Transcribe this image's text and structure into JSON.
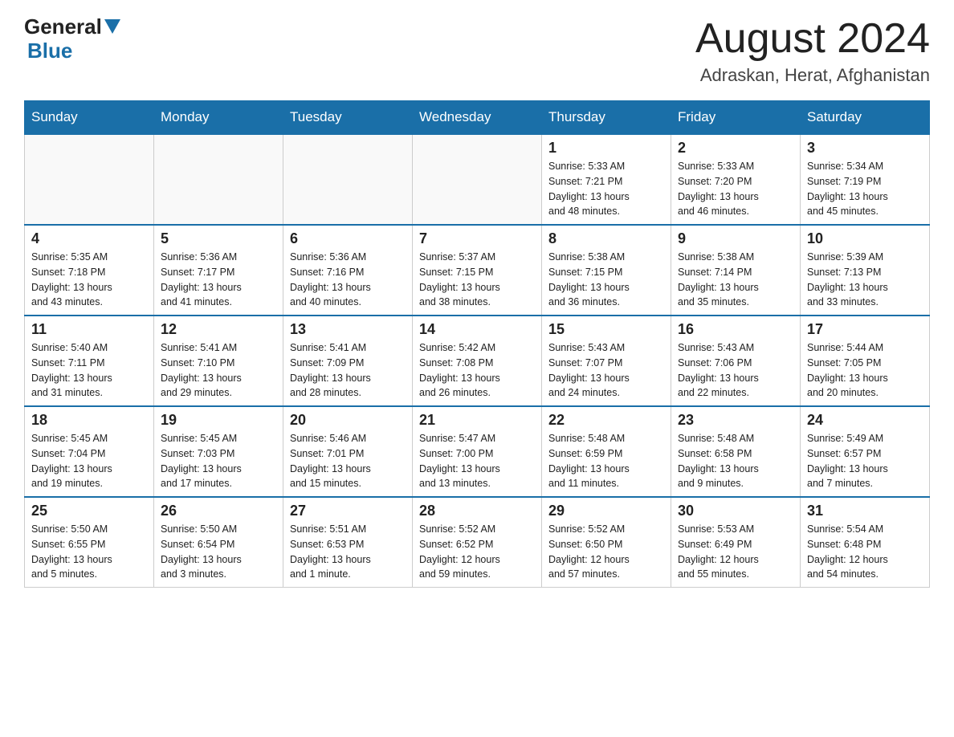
{
  "header": {
    "logo_general": "General",
    "logo_blue": "Blue",
    "month_title": "August 2024",
    "location": "Adraskan, Herat, Afghanistan"
  },
  "days_of_week": [
    "Sunday",
    "Monday",
    "Tuesday",
    "Wednesday",
    "Thursday",
    "Friday",
    "Saturday"
  ],
  "weeks": [
    [
      {
        "day": "",
        "info": ""
      },
      {
        "day": "",
        "info": ""
      },
      {
        "day": "",
        "info": ""
      },
      {
        "day": "",
        "info": ""
      },
      {
        "day": "1",
        "info": "Sunrise: 5:33 AM\nSunset: 7:21 PM\nDaylight: 13 hours\nand 48 minutes."
      },
      {
        "day": "2",
        "info": "Sunrise: 5:33 AM\nSunset: 7:20 PM\nDaylight: 13 hours\nand 46 minutes."
      },
      {
        "day": "3",
        "info": "Sunrise: 5:34 AM\nSunset: 7:19 PM\nDaylight: 13 hours\nand 45 minutes."
      }
    ],
    [
      {
        "day": "4",
        "info": "Sunrise: 5:35 AM\nSunset: 7:18 PM\nDaylight: 13 hours\nand 43 minutes."
      },
      {
        "day": "5",
        "info": "Sunrise: 5:36 AM\nSunset: 7:17 PM\nDaylight: 13 hours\nand 41 minutes."
      },
      {
        "day": "6",
        "info": "Sunrise: 5:36 AM\nSunset: 7:16 PM\nDaylight: 13 hours\nand 40 minutes."
      },
      {
        "day": "7",
        "info": "Sunrise: 5:37 AM\nSunset: 7:15 PM\nDaylight: 13 hours\nand 38 minutes."
      },
      {
        "day": "8",
        "info": "Sunrise: 5:38 AM\nSunset: 7:15 PM\nDaylight: 13 hours\nand 36 minutes."
      },
      {
        "day": "9",
        "info": "Sunrise: 5:38 AM\nSunset: 7:14 PM\nDaylight: 13 hours\nand 35 minutes."
      },
      {
        "day": "10",
        "info": "Sunrise: 5:39 AM\nSunset: 7:13 PM\nDaylight: 13 hours\nand 33 minutes."
      }
    ],
    [
      {
        "day": "11",
        "info": "Sunrise: 5:40 AM\nSunset: 7:11 PM\nDaylight: 13 hours\nand 31 minutes."
      },
      {
        "day": "12",
        "info": "Sunrise: 5:41 AM\nSunset: 7:10 PM\nDaylight: 13 hours\nand 29 minutes."
      },
      {
        "day": "13",
        "info": "Sunrise: 5:41 AM\nSunset: 7:09 PM\nDaylight: 13 hours\nand 28 minutes."
      },
      {
        "day": "14",
        "info": "Sunrise: 5:42 AM\nSunset: 7:08 PM\nDaylight: 13 hours\nand 26 minutes."
      },
      {
        "day": "15",
        "info": "Sunrise: 5:43 AM\nSunset: 7:07 PM\nDaylight: 13 hours\nand 24 minutes."
      },
      {
        "day": "16",
        "info": "Sunrise: 5:43 AM\nSunset: 7:06 PM\nDaylight: 13 hours\nand 22 minutes."
      },
      {
        "day": "17",
        "info": "Sunrise: 5:44 AM\nSunset: 7:05 PM\nDaylight: 13 hours\nand 20 minutes."
      }
    ],
    [
      {
        "day": "18",
        "info": "Sunrise: 5:45 AM\nSunset: 7:04 PM\nDaylight: 13 hours\nand 19 minutes."
      },
      {
        "day": "19",
        "info": "Sunrise: 5:45 AM\nSunset: 7:03 PM\nDaylight: 13 hours\nand 17 minutes."
      },
      {
        "day": "20",
        "info": "Sunrise: 5:46 AM\nSunset: 7:01 PM\nDaylight: 13 hours\nand 15 minutes."
      },
      {
        "day": "21",
        "info": "Sunrise: 5:47 AM\nSunset: 7:00 PM\nDaylight: 13 hours\nand 13 minutes."
      },
      {
        "day": "22",
        "info": "Sunrise: 5:48 AM\nSunset: 6:59 PM\nDaylight: 13 hours\nand 11 minutes."
      },
      {
        "day": "23",
        "info": "Sunrise: 5:48 AM\nSunset: 6:58 PM\nDaylight: 13 hours\nand 9 minutes."
      },
      {
        "day": "24",
        "info": "Sunrise: 5:49 AM\nSunset: 6:57 PM\nDaylight: 13 hours\nand 7 minutes."
      }
    ],
    [
      {
        "day": "25",
        "info": "Sunrise: 5:50 AM\nSunset: 6:55 PM\nDaylight: 13 hours\nand 5 minutes."
      },
      {
        "day": "26",
        "info": "Sunrise: 5:50 AM\nSunset: 6:54 PM\nDaylight: 13 hours\nand 3 minutes."
      },
      {
        "day": "27",
        "info": "Sunrise: 5:51 AM\nSunset: 6:53 PM\nDaylight: 13 hours\nand 1 minute."
      },
      {
        "day": "28",
        "info": "Sunrise: 5:52 AM\nSunset: 6:52 PM\nDaylight: 12 hours\nand 59 minutes."
      },
      {
        "day": "29",
        "info": "Sunrise: 5:52 AM\nSunset: 6:50 PM\nDaylight: 12 hours\nand 57 minutes."
      },
      {
        "day": "30",
        "info": "Sunrise: 5:53 AM\nSunset: 6:49 PM\nDaylight: 12 hours\nand 55 minutes."
      },
      {
        "day": "31",
        "info": "Sunrise: 5:54 AM\nSunset: 6:48 PM\nDaylight: 12 hours\nand 54 minutes."
      }
    ]
  ]
}
